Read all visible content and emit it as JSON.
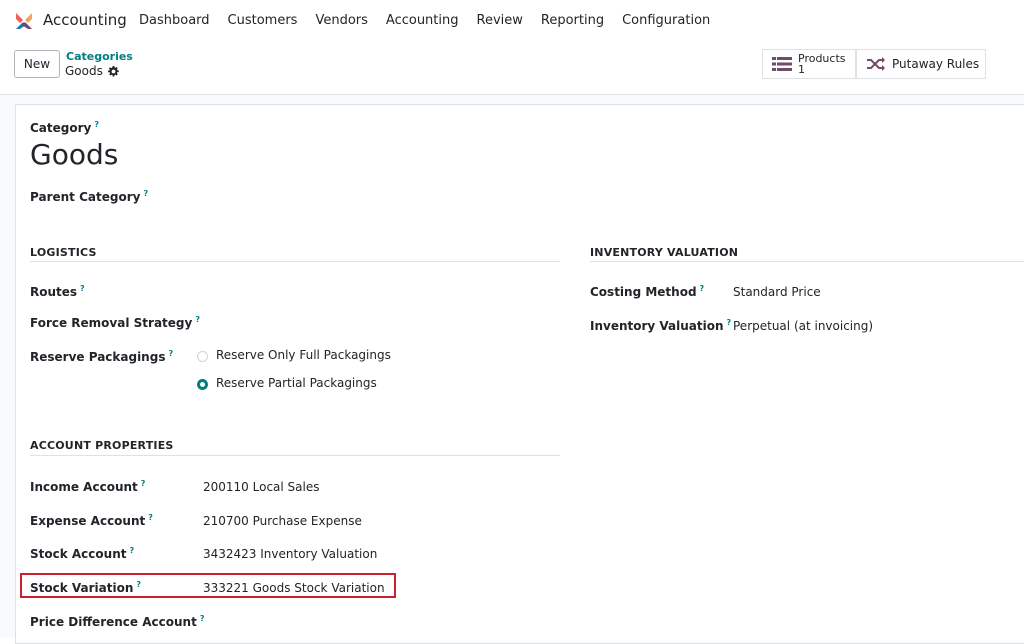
{
  "app": {
    "name": "Accounting"
  },
  "nav": [
    "Dashboard",
    "Customers",
    "Vendors",
    "Accounting",
    "Review",
    "Reporting",
    "Configuration"
  ],
  "control_panel": {
    "new_label": "New",
    "breadcrumb_parent": "Categories",
    "breadcrumb_current": "Goods",
    "products_label": "Products",
    "products_count": "1",
    "putaway_label": "Putaway Rules"
  },
  "form": {
    "category_label": "Category",
    "category_name": "Goods",
    "parent_category_label": "Parent Category",
    "help_mark": "?",
    "logistics": {
      "title": "LOGISTICS",
      "routes_label": "Routes",
      "force_removal_label": "Force Removal Strategy",
      "reserve_packagings_label": "Reserve Packagings",
      "option_full": "Reserve Only Full Packagings",
      "option_partial": "Reserve Partial Packagings",
      "selected": "partial"
    },
    "inventory_valuation": {
      "title": "INVENTORY VALUATION",
      "costing_method_label": "Costing Method",
      "costing_method_value": "Standard Price",
      "inventory_valuation_label": "Inventory Valuation",
      "inventory_valuation_value": "Perpetual (at invoicing)"
    },
    "account_properties": {
      "title": "ACCOUNT PROPERTIES",
      "income_label": "Income Account",
      "income_value": "200110 Local Sales",
      "expense_label": "Expense Account",
      "expense_value": "210700 Purchase Expense",
      "stock_label": "Stock Account",
      "stock_value": "3432423 Inventory Valuation",
      "stock_variation_label": "Stock Variation",
      "stock_variation_value": "333221 Goods Stock Variation",
      "price_diff_label": "Price Difference Account"
    }
  },
  "colors": {
    "accent": "#017e84",
    "highlight": "#c8212f"
  }
}
